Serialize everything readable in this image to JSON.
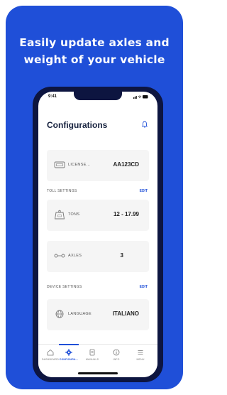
{
  "headline": {
    "line1": "Easily update axles and",
    "line2": "weight of your vehicle"
  },
  "status_bar": {
    "time": "9:41",
    "icons": "…• ▤"
  },
  "app": {
    "title": "Configurations",
    "license": {
      "label": "LICENSE...",
      "value": "AA123CD"
    },
    "toll_settings": {
      "heading": "TOLL SETTINGS",
      "edit_label": "EDIT",
      "tons": {
        "label": "TONS",
        "value": "12 - 17.99"
      },
      "axles": {
        "label": "AXLES",
        "value": "3"
      }
    },
    "device_settings": {
      "heading": "DEVICE SETTINGS",
      "edit_label": "EDIT",
      "language": {
        "label": "LANGUAGE",
        "value": "ITALIANO"
      }
    },
    "tabs": [
      {
        "label": "DASHBOARD",
        "icon": "home-icon"
      },
      {
        "label": "CONFIGURA...",
        "icon": "gear-icon",
        "active": true
      },
      {
        "label": "MANUALS",
        "icon": "book-icon"
      },
      {
        "label": "INFO",
        "icon": "info-icon"
      },
      {
        "label": "MENU",
        "icon": "menu-icon"
      }
    ]
  },
  "colors": {
    "brand": "#1f4fd8",
    "phone_frame": "#0d1540",
    "row_background": "#f5f5f5"
  }
}
